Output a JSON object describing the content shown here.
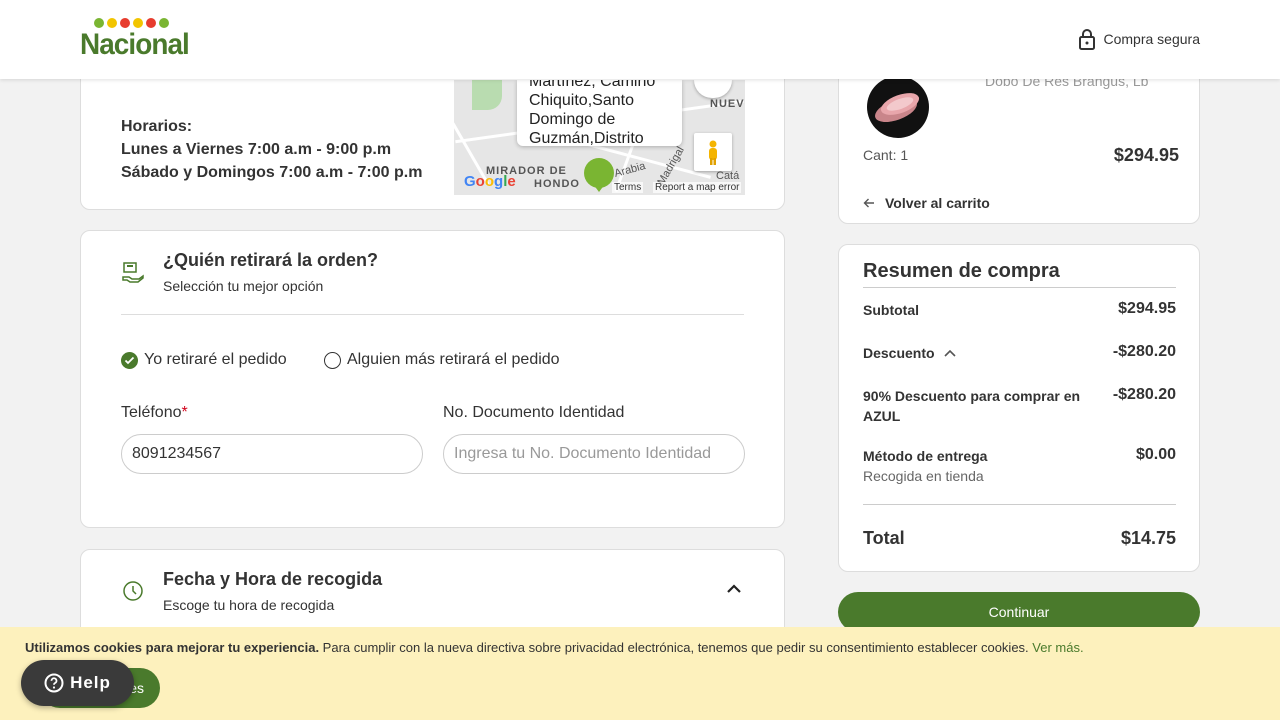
{
  "header": {
    "brand": "Nacional",
    "secure_label": "Compra segura"
  },
  "store": {
    "hours_title": "Horarios:",
    "hours_weekdays": "Lunes a Viernes 7:00 a.m - 9:00 p.m",
    "hours_weekend": "Sábado y Domingos 7:00 a.m - 7:00 p.m",
    "map": {
      "popup_lines": [
        "Martínez, Camino",
        "Chiquito,Santo",
        "Domingo de",
        "Guzmán,Distrito"
      ],
      "labels": [
        "MIRADOR DE",
        "HONDO",
        "NUEVO",
        "Arabia",
        "Madrigal",
        "Catá"
      ],
      "google": "Google",
      "terms": "Terms",
      "report": "Report a map error"
    }
  },
  "who": {
    "title": "¿Quién retirará la orden?",
    "subtitle": "Selección tu mejor opción",
    "option_self": "Yo retiraré el pedido",
    "option_other": "Alguien más retirará el pedido",
    "phone_label": "Teléfono",
    "phone_required": "*",
    "phone_value": "8091234567",
    "doc_label": "No. Documento Identidad",
    "doc_placeholder": "Ingresa tu No. Documento Identidad"
  },
  "pickup": {
    "title": "Fecha y Hora de recogida",
    "subtitle": "Escoge tu hora de recogida"
  },
  "cart": {
    "product_name": "Dobo De Res Brangus, Lb",
    "qty": "Cant: 1",
    "price": "$294.95",
    "back_label": "Volver al carrito"
  },
  "summary": {
    "title": "Resumen de compra",
    "subtotal_label": "Subtotal",
    "subtotal_value": "$294.95",
    "discount_label": "Descuento",
    "discount_value": "-$280.20",
    "promo_label": "90% Descuento para comprar en AZUL",
    "promo_value": "-$280.20",
    "delivery_label": "Método de entrega",
    "delivery_sub": "Recogida en tienda",
    "delivery_value": "$0.00",
    "total_label": "Total",
    "total_value": "$14.75",
    "continue_label": "Continuar"
  },
  "cookie": {
    "bold_text": "Utilizamos cookies para mejorar tu experiencia.",
    "text": " Para cumplir con la nueva directiva sobre privacidad electrónica, tenemos que pedir su consentimiento establecer cookies.",
    "link": "Ver más.",
    "accept_label": "es",
    "help_label": "Help"
  },
  "colors": {
    "brand_green": "#4a7a2c",
    "cookie_bg": "#fdf1bd"
  }
}
